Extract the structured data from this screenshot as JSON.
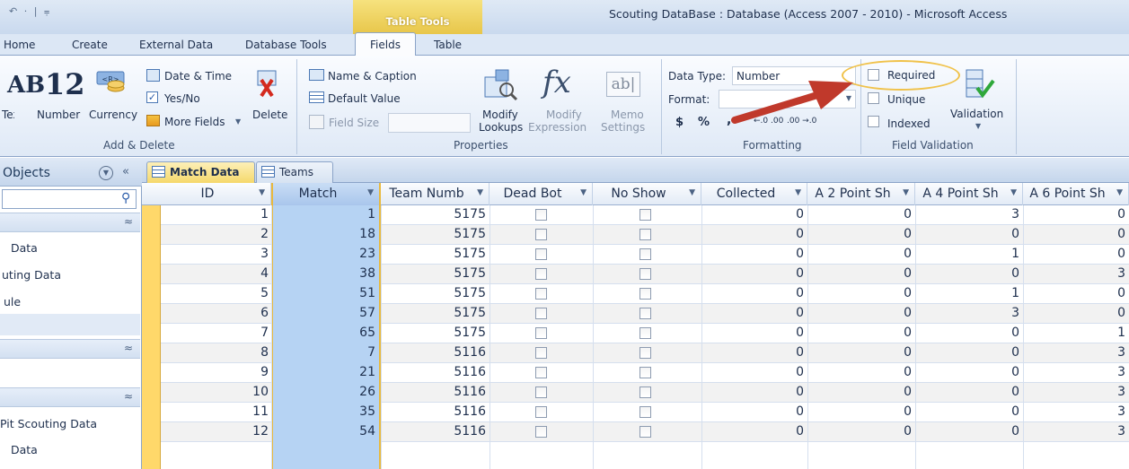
{
  "window": {
    "title": "Scouting DataBase : Database (Access 2007 - 2010)  -  Microsoft Access",
    "quick_access": "↶ · | ⩦",
    "contextual_band": "Table Tools"
  },
  "ribbon_tabs": [
    "Home",
    "Create",
    "External Data",
    "Database Tools",
    "Fields",
    "Table"
  ],
  "ribbon": {
    "add_delete": {
      "label": "Add & Delete",
      "ab_text": "AB",
      "text_label": "Text",
      "number_big": "12",
      "number_label": "Number",
      "currency_label": "Currency",
      "date_time": "Date & Time",
      "yes_no": "Yes/No",
      "more_fields": "More Fields",
      "delete": "Delete"
    },
    "properties": {
      "label": "Properties",
      "name_caption": "Name & Caption",
      "default_value": "Default Value",
      "field_size": "Field Size",
      "modify_lookups": [
        "Modify",
        "Lookups"
      ],
      "modify_expression": [
        "Modify",
        "Expression"
      ],
      "memo_settings": [
        "Memo",
        "Settings"
      ]
    },
    "formatting": {
      "label": "Formatting",
      "data_type_label": "Data Type:",
      "data_type_value": "Number",
      "format_label": "Format:",
      "format_value": "",
      "currency_symbol": "$",
      "percent_symbol": "%",
      "comma_symbol": ",",
      "inc_decimals": "←.0 .00",
      "dec_decimals": ".00 →.0"
    },
    "field_validation": {
      "label": "Field Validation",
      "required": "Required",
      "unique": "Unique",
      "indexed": "Indexed",
      "validation": "Validation"
    }
  },
  "nav_pane": {
    "title": "All Access Objects",
    "search_placeholder": "",
    "items": [
      "Match Data",
      "Pit Scouting Data",
      "Schedule",
      "Pit Scouting Data",
      "Match Data"
    ],
    "visible_items": [
      "Data",
      "uting Data",
      "ule",
      "Pit Scouting Data",
      "Data"
    ],
    "visible_title": "Objects"
  },
  "doc_tabs": [
    "Match Data",
    "Teams"
  ],
  "table": {
    "columns": [
      "ID",
      "Match",
      "Team Numb",
      "Dead Bot",
      "No Show",
      "Collected",
      "A 2 Point Sh",
      "A 4 Point Sh",
      "A 6 Point Sh"
    ],
    "rows": [
      {
        "id": 1,
        "match": 1,
        "team": 5175,
        "collected": 0,
        "a2": 0,
        "a4": 3,
        "a6": 0
      },
      {
        "id": 2,
        "match": 18,
        "team": 5175,
        "collected": 0,
        "a2": 0,
        "a4": 0,
        "a6": 0
      },
      {
        "id": 3,
        "match": 23,
        "team": 5175,
        "collected": 0,
        "a2": 0,
        "a4": 1,
        "a6": 0
      },
      {
        "id": 4,
        "match": 38,
        "team": 5175,
        "collected": 0,
        "a2": 0,
        "a4": 0,
        "a6": 3
      },
      {
        "id": 5,
        "match": 51,
        "team": 5175,
        "collected": 0,
        "a2": 0,
        "a4": 1,
        "a6": 0
      },
      {
        "id": 6,
        "match": 57,
        "team": 5175,
        "collected": 0,
        "a2": 0,
        "a4": 3,
        "a6": 0
      },
      {
        "id": 7,
        "match": 65,
        "team": 5175,
        "collected": 0,
        "a2": 0,
        "a4": 0,
        "a6": 1
      },
      {
        "id": 8,
        "match": 7,
        "team": 5116,
        "collected": 0,
        "a2": 0,
        "a4": 0,
        "a6": 3
      },
      {
        "id": 9,
        "match": 21,
        "team": 5116,
        "collected": 0,
        "a2": 0,
        "a4": 0,
        "a6": 3
      },
      {
        "id": 10,
        "match": 26,
        "team": 5116,
        "collected": 0,
        "a2": 0,
        "a4": 0,
        "a6": 3
      },
      {
        "id": 11,
        "match": 35,
        "team": 5116,
        "collected": 0,
        "a2": 0,
        "a4": 0,
        "a6": 3
      },
      {
        "id": 12,
        "match": 54,
        "team": 5116,
        "collected": 0,
        "a2": 0,
        "a4": 0,
        "a6": 3
      }
    ]
  },
  "colors": {
    "accent_yellow": "#e8b93e",
    "selected_column": "#b6d3f3",
    "annotation_arrow": "#c0392b"
  }
}
